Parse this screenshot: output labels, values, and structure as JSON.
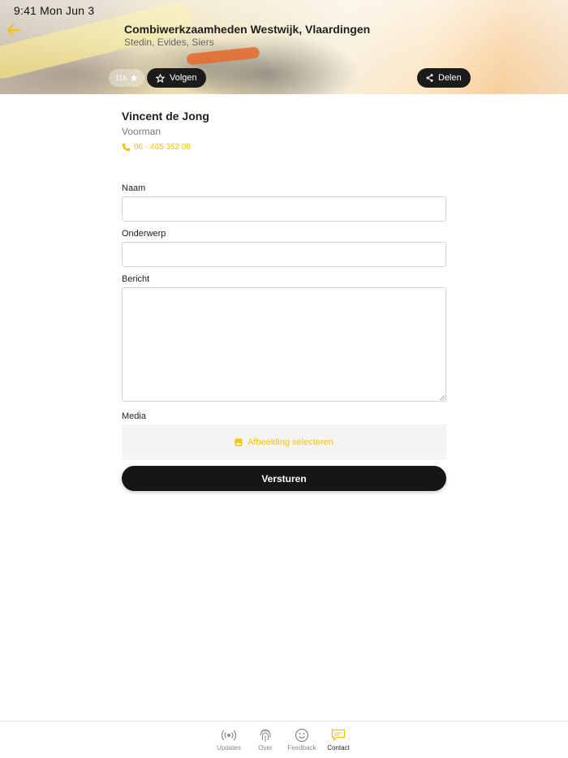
{
  "status_bar": {
    "time": "9:41 Mon Jun 3"
  },
  "header": {
    "title": "Combiwerkzaamheden Westwijk, Vlaardingen",
    "subtitle": "Stedin, Evides, Siers",
    "follow_count": "116",
    "follow_label": "Volgen",
    "share_label": "Delen"
  },
  "contact": {
    "name": "Vincent de Jong",
    "role": "Voorman",
    "phone": "06 - 465 352 08"
  },
  "form": {
    "name_label": "Naam",
    "name_value": "",
    "subject_label": "Onderwerp",
    "subject_value": "",
    "message_label": "Bericht",
    "message_value": "",
    "media_label": "Media",
    "media_button": "Afbeelding selecteren",
    "submit_label": "Versturen"
  },
  "tabs": [
    {
      "label": "Updates",
      "icon": "broadcast-icon"
    },
    {
      "label": "Over",
      "icon": "fingerprint-icon"
    },
    {
      "label": "Feedback",
      "icon": "smiley-icon"
    },
    {
      "label": "Contact",
      "icon": "chat-icon",
      "active": true
    }
  ],
  "colors": {
    "accent": "#f5c400",
    "dark": "#161616"
  }
}
